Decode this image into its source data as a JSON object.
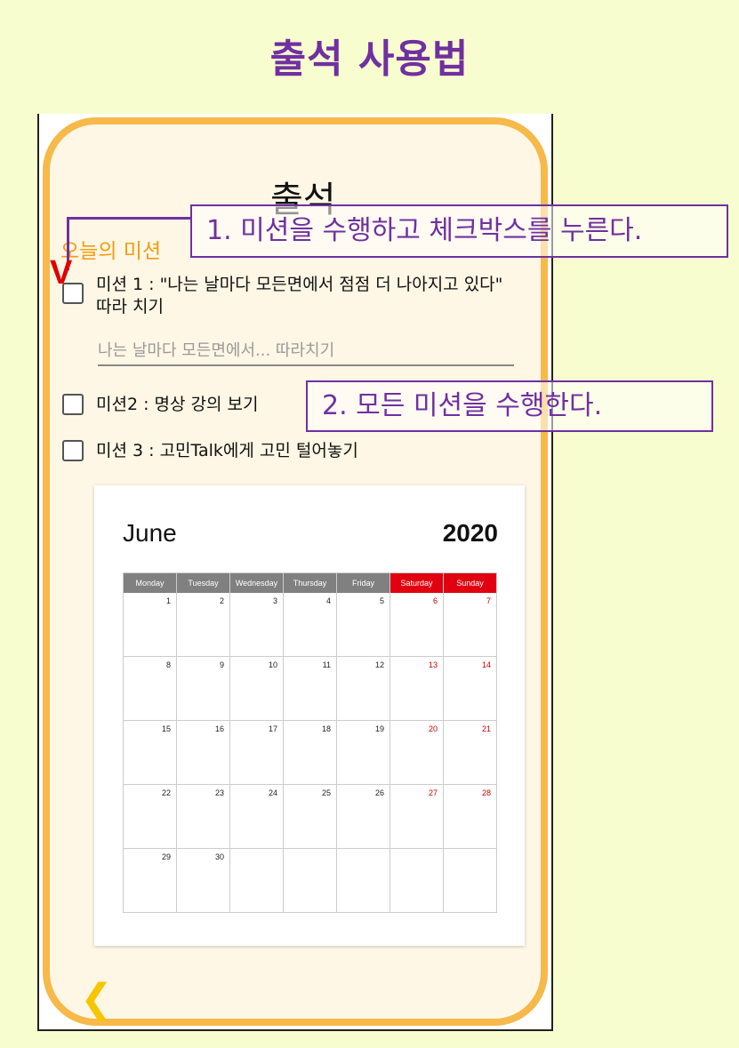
{
  "page_title": "출석 사용법",
  "screen": {
    "title": "출석",
    "section_label": "오늘의 미션",
    "missions": [
      {
        "label": "미션 1 : \"나는 날마다 모든면에서 점점 더 나아지고 있다\" 따라 치기",
        "checked": true
      },
      {
        "label": "미션2 : 명상 강의 보기",
        "checked": false
      },
      {
        "label": "미션 3 : 고민Talk에게 고민 털어놓기",
        "checked": false
      }
    ],
    "input_placeholder": "나는 날마다 모든면에서... 따라치기",
    "back_icon": "chevron-left-icon"
  },
  "calendar": {
    "month": "June",
    "year": "2020",
    "weekdays": [
      "Monday",
      "Tuesday",
      "Wednesday",
      "Thursday",
      "Friday",
      "Saturday",
      "Sunday"
    ],
    "weekend_color": "#e00010",
    "weeks": [
      [
        "1",
        "2",
        "3",
        "4",
        "5",
        "6",
        "7"
      ],
      [
        "8",
        "9",
        "10",
        "11",
        "12",
        "13",
        "14"
      ],
      [
        "15",
        "16",
        "17",
        "18",
        "19",
        "20",
        "21"
      ],
      [
        "22",
        "23",
        "24",
        "25",
        "26",
        "27",
        "28"
      ],
      [
        "29",
        "30",
        "",
        "",
        "",
        "",
        ""
      ]
    ]
  },
  "annotations": {
    "callout_1": "1. 미션을 수행하고 체크박스를 누른다.",
    "callout_2": "2. 모든 미션을 수행한다.",
    "check_mark": "V",
    "color": "#7030a0"
  }
}
